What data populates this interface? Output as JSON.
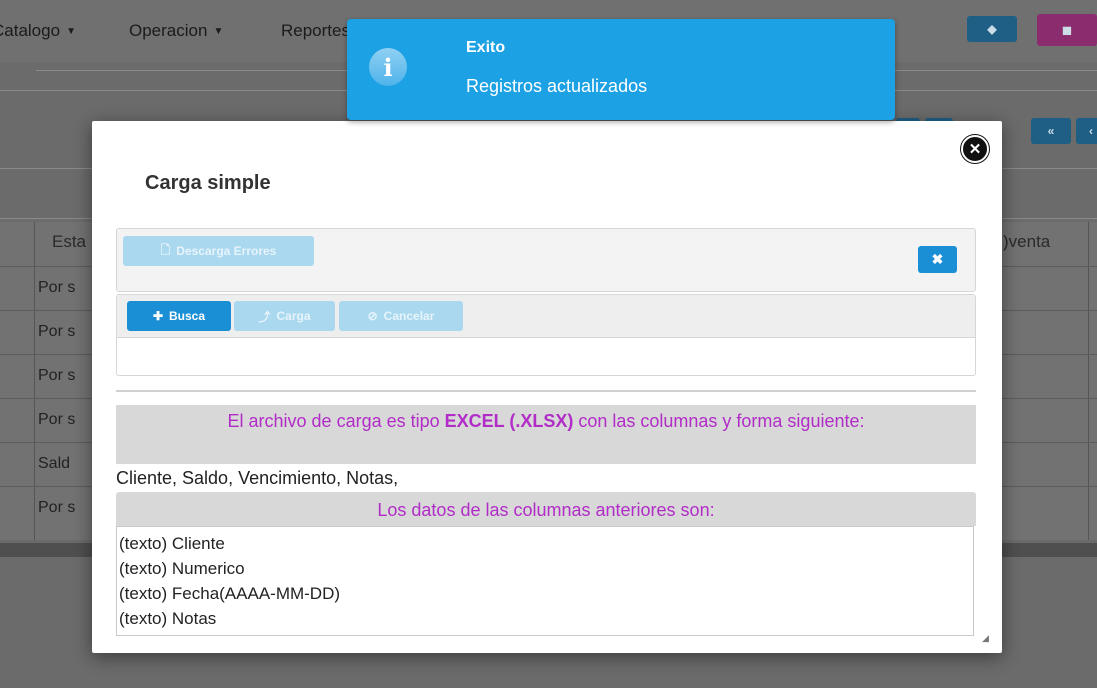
{
  "background": {
    "menu": [
      "Catalogo",
      "Operacion",
      "Reportes"
    ],
    "table_header_left": "Esta",
    "table_header_right": ")venta",
    "rows": [
      "Por s",
      "Por s",
      "Por s",
      "Por s",
      "Sald",
      "Por s"
    ]
  },
  "notification": {
    "icon": "info-icon",
    "title": "Exito",
    "message": "Registros actualizados",
    "color": "#1ca1e4"
  },
  "modal": {
    "title": "Carga simple",
    "close_icon": "close-icon",
    "download_errors_label": "Descarga Errores",
    "dismiss_label": "✖",
    "toolbar": {
      "search_label": "Busca",
      "upload_label": "Carga",
      "cancel_label": "Cancelar"
    },
    "info": {
      "prefix": "El archivo de carga es tipo ",
      "format": "EXCEL (.XLSX)",
      "suffix": " con las columnas y forma siguiente:"
    },
    "columns_line": "Cliente, Saldo, Vencimiento, Notas,",
    "data_header": "Los datos de las columnas anteriores son:",
    "data_lines": [
      "(texto) Cliente",
      "(texto) Numerico",
      "(texto) Fecha(AAAA-MM-DD)",
      "(texto) Notas"
    ],
    "accent_color": "#1a8fd6",
    "info_text_color": "#b22cc8"
  }
}
